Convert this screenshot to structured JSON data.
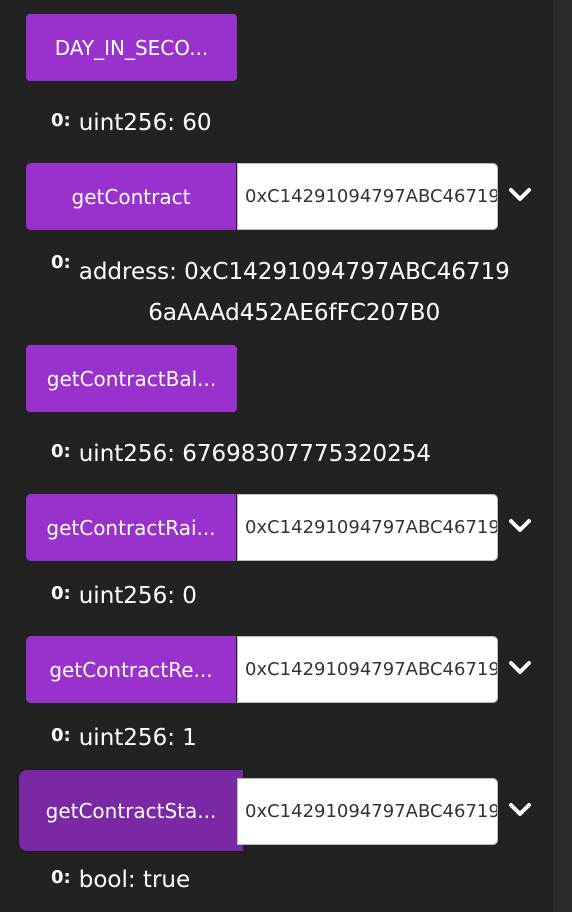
{
  "functions": [
    {
      "label": "DAY_IN_SECO...",
      "output": "uint256: 60"
    },
    {
      "label": "getContract",
      "input": "0xC14291094797ABC46719",
      "output": "address: 0xC14291094797ABC46719",
      "output_line2": "6aAAAd452AE6fFC207B0"
    },
    {
      "label": "getContractBal...",
      "output": "uint256: 67698307775320254"
    },
    {
      "label": "getContractRai...",
      "input": "0xC14291094797ABC46719",
      "output": "uint256: 0"
    },
    {
      "label": "getContractRe...",
      "input": "0xC14291094797ABC46719",
      "output": "uint256: 1"
    },
    {
      "label": "getContractSta...",
      "input": "0xC14291094797ABC46719",
      "output": "bool: true"
    }
  ],
  "output_index": "0:",
  "colors": {
    "button": "#9932cc",
    "button_active": "#7a28a3",
    "background": "#222222"
  }
}
